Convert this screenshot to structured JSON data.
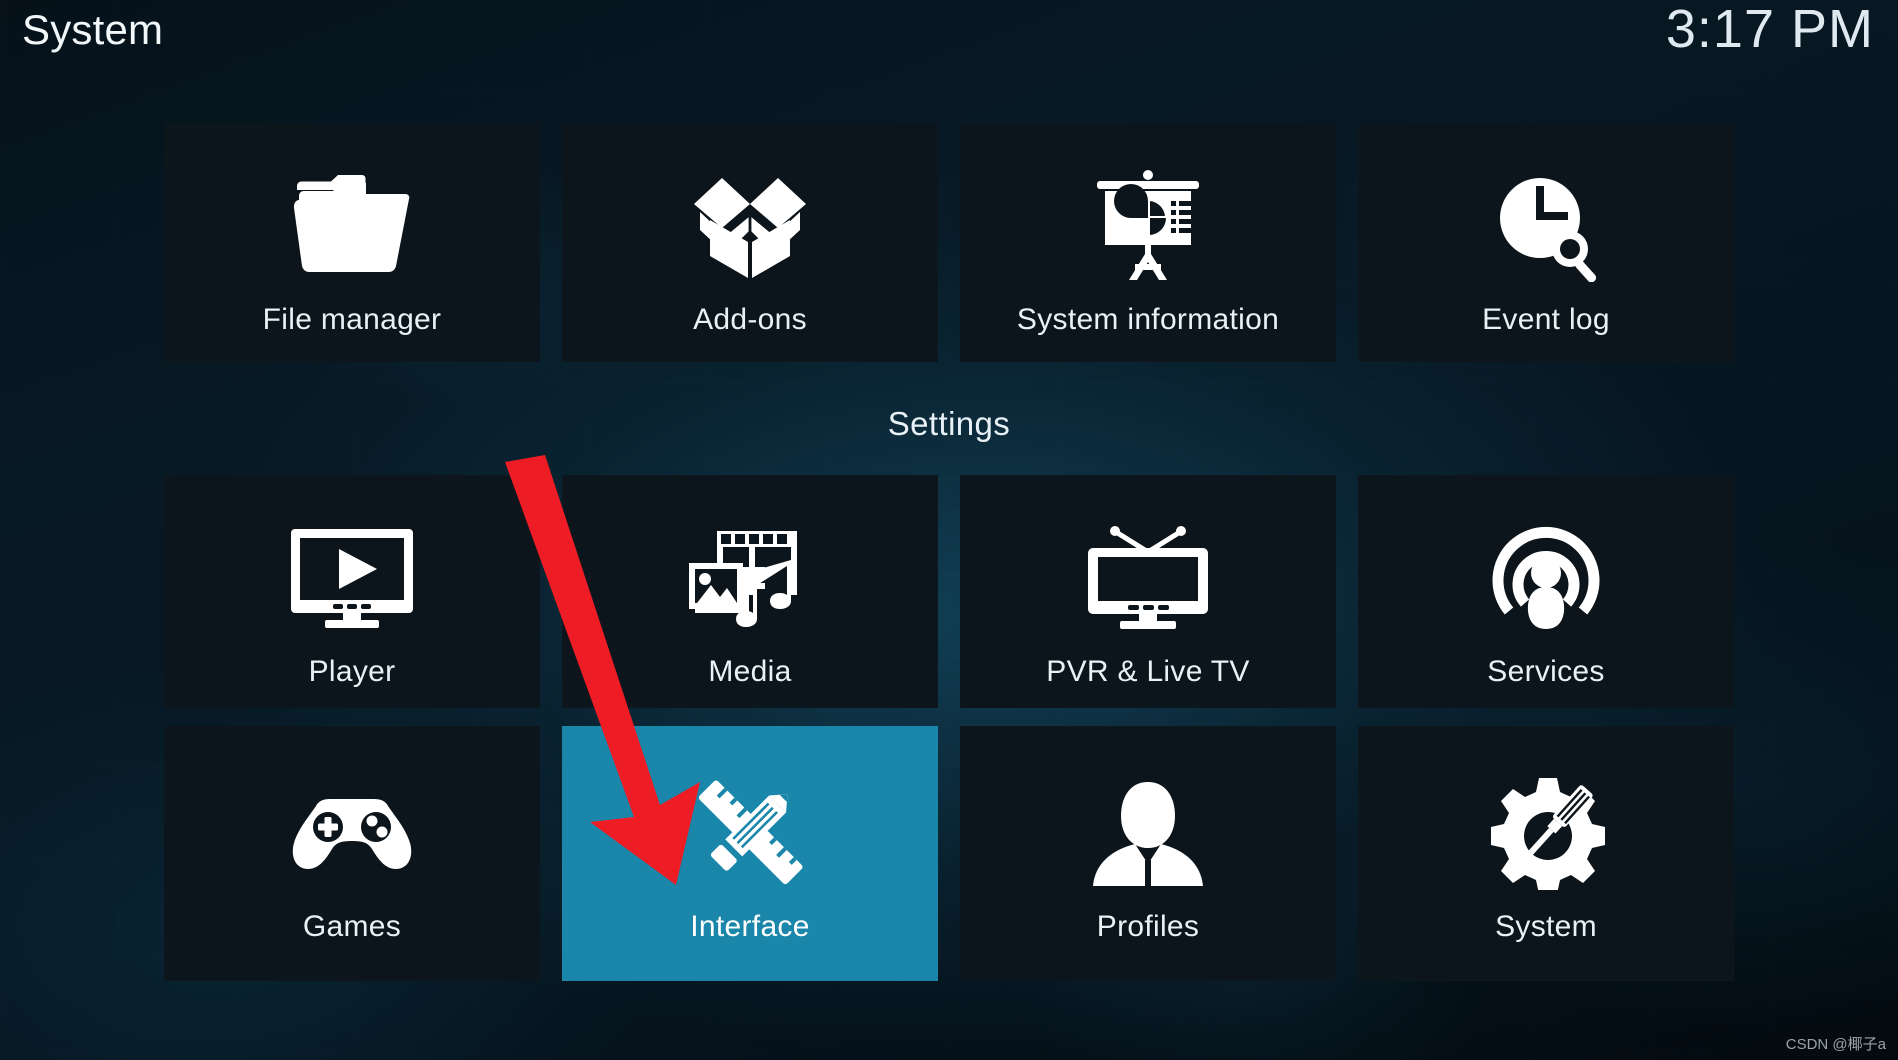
{
  "header": {
    "title": "System",
    "clock": "3:17 PM"
  },
  "groups": {
    "settings_heading": "Settings"
  },
  "colors": {
    "selection": "#1a87aa",
    "tile_background": "#0c151b",
    "text": "#e9f1f5",
    "annotation_arrow": "#ee1c25"
  },
  "rows": {
    "top": [
      {
        "label": "File manager",
        "icon": "folder-icon",
        "selected": false
      },
      {
        "label": "Add-ons",
        "icon": "open-box-icon",
        "selected": false
      },
      {
        "label": "System information",
        "icon": "presentation-chart-icon",
        "selected": false
      },
      {
        "label": "Event log",
        "icon": "clock-search-icon",
        "selected": false
      }
    ],
    "middle": [
      {
        "label": "Player",
        "icon": "monitor-play-icon",
        "selected": false
      },
      {
        "label": "Media",
        "icon": "film-picture-music-icon",
        "selected": false
      },
      {
        "label": "PVR & Live TV",
        "icon": "television-antenna-icon",
        "selected": false
      },
      {
        "label": "Services",
        "icon": "broadcast-person-icon",
        "selected": false
      }
    ],
    "bottom": [
      {
        "label": "Games",
        "icon": "gamepad-icon",
        "selected": false
      },
      {
        "label": "Interface",
        "icon": "pencil-ruler-icon",
        "selected": true
      },
      {
        "label": "Profiles",
        "icon": "person-silhouette-icon",
        "selected": false
      },
      {
        "label": "System",
        "icon": "gear-screwdriver-icon",
        "selected": false
      }
    ]
  },
  "annotations": {
    "arrow_target": "Interface"
  },
  "watermark": "CSDN @椰子a"
}
